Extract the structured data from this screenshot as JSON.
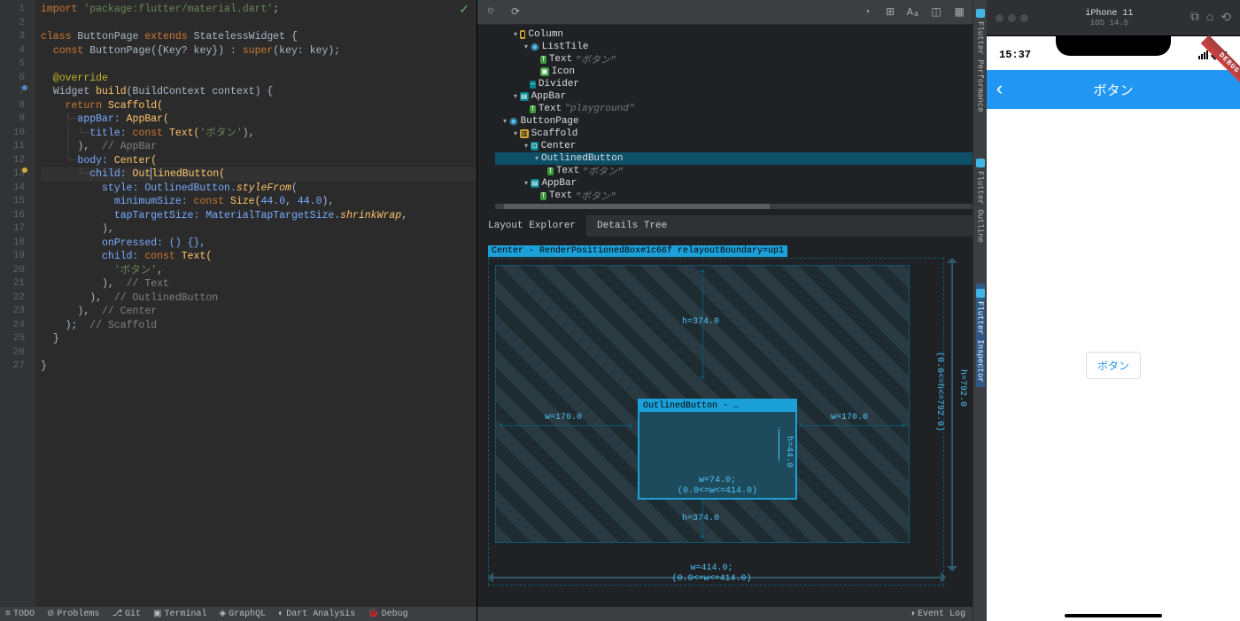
{
  "editor": {
    "lines": [
      "1",
      "2",
      "3",
      "4",
      "5",
      "6",
      "7",
      "8",
      "9",
      "10",
      "11",
      "12",
      "13",
      "14",
      "15",
      "16",
      "17",
      "18",
      "19",
      "20",
      "21",
      "22",
      "23",
      "24",
      "25",
      "26",
      "27"
    ],
    "code": {
      "l1_import": "import ",
      "l1_pkg": "'package:flutter/material.dart'",
      "l1_semi": ";",
      "l3_class": "class ",
      "l3_name": "ButtonPage ",
      "l3_extends": "extends ",
      "l3_parent": "StatelessWidget {",
      "l4_const": "const ",
      "l4_ctor": "ButtonPage({Key? key}) : ",
      "l4_super": "super",
      "l4_args": "(key: key);",
      "l6_override": "@override",
      "l7_widget": "Widget ",
      "l7_build": "build",
      "l7_params": "(BuildContext context) {",
      "l8_return": "return ",
      "l8_scaffold": "Scaffold(",
      "l9_appbar": "appBar: ",
      "l9_appbarv": "AppBar(",
      "l10_title": "title: ",
      "l10_const": "const ",
      "l10_text": "Text(",
      "l10_str": "'ボタン'",
      "l10_end": "),",
      "l11_close": "),  ",
      "l11_cmt": "// AppBar",
      "l12_body": "body: ",
      "l12_center": "Center(",
      "l13_child": "child: ",
      "l13_btn": "OutlinedButton(",
      "l14_style": "style: OutlinedButton.",
      "l14_from": "styleFrom",
      "l14_open": "(",
      "l15_min": "minimumSize: ",
      "l15_const": "const ",
      "l15_size": "Size(",
      "l15_n1": "44.0",
      "l15_c": ", ",
      "l15_n2": "44.0",
      "l15_end": "),",
      "l16_tap": "tapTargetSize: MaterialTapTargetSize.",
      "l16_shrink": "shrinkWrap",
      "l16_end": ",",
      "l17_close": "),",
      "l18_press": "onPressed: () {},",
      "l19_child": "child: ",
      "l19_const": "const ",
      "l19_text": "Text(",
      "l20_str": "'ボタン'",
      "l20_end": ",",
      "l21_close": "),  ",
      "l21_cmt": "// Text",
      "l22_close": "),  ",
      "l22_cmt": "// OutlinedButton",
      "l23_close": "),  ",
      "l23_cmt": "// Center",
      "l24_close": ");  ",
      "l24_cmt": "// Scaffold",
      "l25_brace": "}",
      "l27_brace": "}"
    }
  },
  "statusbar": {
    "todo": "TODO",
    "problems": "Problems",
    "git": "Git",
    "terminal": "Terminal",
    "graphql": "GraphQL",
    "dart": "Dart Analysis",
    "debug": "Debug",
    "eventlog": "Event Log"
  },
  "devtools": {
    "tree": {
      "column": "Column",
      "listtile": "ListTile",
      "text1": "Text",
      "text1v": "\"ボタン\"",
      "icon": "Icon",
      "divider": "Divider",
      "appbar1": "AppBar",
      "text2": "Text",
      "text2v": "\"playground\"",
      "buttonpage": "ButtonPage",
      "scaffold": "Scaffold",
      "center": "Center",
      "outlinedbutton": "OutlinedButton",
      "text3": "Text",
      "text3v": "\"ボタン\"",
      "appbar2": "AppBar",
      "text4": "Text",
      "text4v": "\"ボタン\""
    },
    "tabs": {
      "layout": "Layout Explorer",
      "details": "Details Tree"
    },
    "layout": {
      "title": "Center - RenderPositionedBox#1c66f relayoutBoundary=up1",
      "inner_title": "OutlinedButton - …",
      "h_top": "h=374.0",
      "h_bot": "h=374.0",
      "w_left": "w=170.0",
      "w_right": "w=170.0",
      "inner_h": "h=44.0",
      "inner_w": "w=74.0;",
      "inner_wc": "(0.0<=w<=414.0)",
      "outer_h": "h=792.0",
      "outer_hc": "(0.0<=h<=792.0)",
      "outer_w": "w=414.0;",
      "outer_wc": "(0.0<=w<=414.0)"
    }
  },
  "rail": {
    "perf": "Flutter Performance",
    "outline": "Flutter Outline",
    "inspector": "Flutter Inspector"
  },
  "sim": {
    "device": "iPhone 11",
    "os": "iOS 14.5",
    "time": "15:37",
    "debug": "DEBUG",
    "appbar_title": "ボタン",
    "button_text": "ボタン"
  }
}
